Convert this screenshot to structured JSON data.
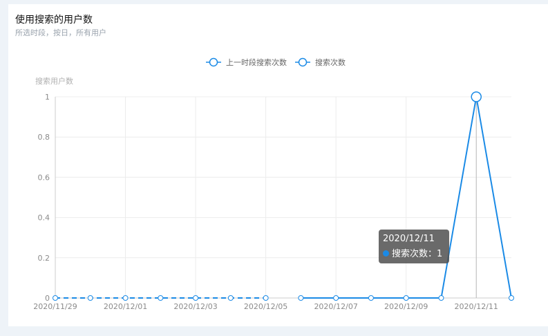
{
  "header": {
    "title": "使用搜索的用户数",
    "subtitle": "所选时段，按日，所有用户"
  },
  "colors": {
    "series": "#1a8ae6",
    "grid": "#ececec",
    "axis": "#cccccc"
  },
  "tooltip": {
    "date": "2020/12/11",
    "series": "搜索次数",
    "separator": "：",
    "value": "1"
  },
  "chart_data": {
    "type": "line",
    "title": "使用搜索的用户数",
    "subtitle": "所选时段，按日，所有用户",
    "ylabel": "搜索用户数",
    "xlabel": "",
    "ylim": [
      0,
      1
    ],
    "yticks": [
      "0",
      "0.2",
      "0.4",
      "0.6",
      "0.8",
      "1"
    ],
    "x": [
      "2020/11/29",
      "2020/11/30",
      "2020/12/01",
      "2020/12/02",
      "2020/12/03",
      "2020/12/04",
      "2020/12/05",
      "2020/12/06",
      "2020/12/07",
      "2020/12/08",
      "2020/12/09",
      "2020/12/10",
      "2020/12/11",
      "2020/12/12"
    ],
    "xtick_labels": [
      "2020/11/29",
      "2020/12/01",
      "2020/12/03",
      "2020/12/05",
      "2020/12/07",
      "2020/12/09",
      "2020/12/11"
    ],
    "legend_position": "top-center",
    "grid": true,
    "series": [
      {
        "name": "上一时段搜索次数",
        "style": "dashed",
        "values": [
          0,
          0,
          0,
          0,
          0,
          0,
          0,
          null,
          null,
          null,
          null,
          null,
          null,
          null
        ]
      },
      {
        "name": "搜索次数",
        "style": "solid",
        "values": [
          null,
          null,
          null,
          null,
          null,
          null,
          null,
          0,
          0,
          0,
          0,
          0,
          1,
          0
        ]
      }
    ]
  }
}
